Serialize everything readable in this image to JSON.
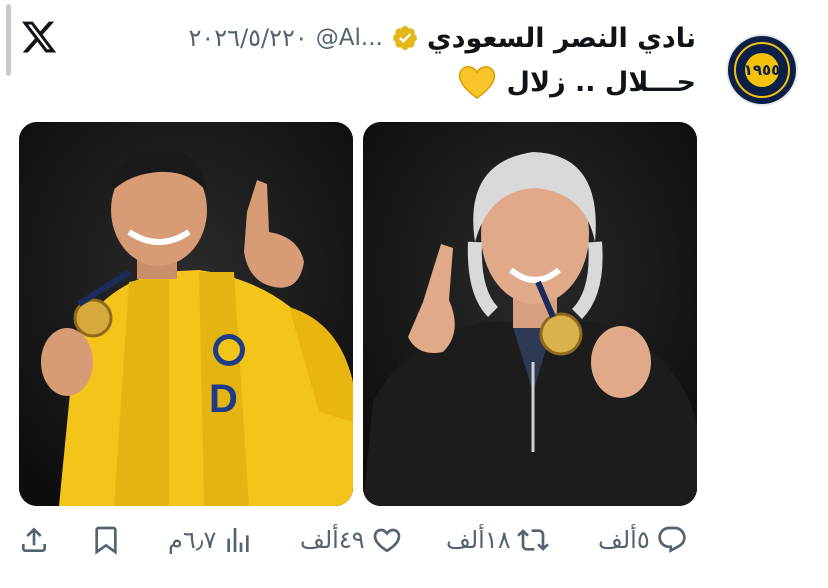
{
  "account": {
    "name": "نادي النصر السعودي",
    "handle": "@Al...",
    "date": "٢٠٢٦/٥/٢٢٠",
    "avatar_text": "١٩٥٥"
  },
  "tweet": {
    "text": "حـــلال .. زلال"
  },
  "actions": {
    "replies": "٥ألف",
    "retweets": "١٨ألف",
    "likes": "٤٩ألف",
    "views": "٦٫٧م"
  },
  "colors": {
    "text": "#0f1419",
    "muted": "#536471",
    "gold": "#f4c20d",
    "navy": "#0c1f46"
  },
  "icons": [
    "x-logo-icon",
    "verified-icon",
    "yellow-heart-icon",
    "reply-icon",
    "retweet-icon",
    "like-icon",
    "views-icon",
    "bookmark-icon",
    "share-icon"
  ]
}
